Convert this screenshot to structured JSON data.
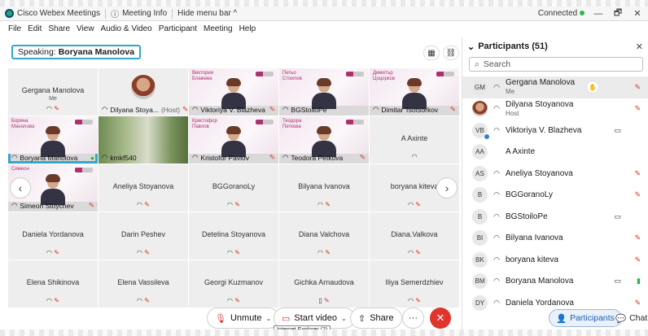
{
  "titlebar": {
    "app_name": "Cisco Webex Meetings",
    "meeting_info": "Meeting Info",
    "hide_menu": "Hide menu bar ^",
    "status": "Connected",
    "minimize": "—",
    "restore": "🗗",
    "close": "✕"
  },
  "menu": [
    "File",
    "Edit",
    "Share",
    "View",
    "Audio & Video",
    "Participant",
    "Meeting",
    "Help"
  ],
  "stage": {
    "speaking_prefix": "Speaking:",
    "speaking_name": "Boryana Manolova",
    "layout_icon": "grid-icon",
    "lock_icon": "link-icon"
  },
  "tiles": [
    {
      "name": "Gergana Manolova",
      "sub": "Me",
      "kind": "plain",
      "mic": "muted"
    },
    {
      "name": "Dilyana Stoya...",
      "extra": "(Host)",
      "kind": "avatar",
      "mic": "muted"
    },
    {
      "name": "Viktoriya V. Blazheva",
      "kind": "video",
      "slide": "Виктория\nБлажева",
      "mic": "muted"
    },
    {
      "name": "BGStoiloPe",
      "kind": "video",
      "slide": "Петьо\nСтоилов",
      "mic": "none"
    },
    {
      "name": "Dimitar Tsotsorkov",
      "kind": "video",
      "slide": "Димитър\nЦоцорков",
      "mic": "muted"
    },
    {
      "name": "Boryana Manolova",
      "kind": "video",
      "slide": "Боряна\nМанолова",
      "mic": "active",
      "active": true
    },
    {
      "name": "kmkf540",
      "kind": "forest",
      "mic": "none"
    },
    {
      "name": "Kristofor Pavlov",
      "kind": "video",
      "slide": "Кристофор\nПавлов",
      "mic": "muted"
    },
    {
      "name": "Teodora Petkova",
      "kind": "video",
      "slide": "Теодора\nПеткова",
      "mic": "muted"
    },
    {
      "name": "A Axinte",
      "kind": "plain",
      "mic": "none"
    },
    {
      "name": "Simeon Stoychev",
      "kind": "video",
      "slide": "Симеон",
      "mic": "muted"
    },
    {
      "name": "Aneliya Stoyanova",
      "kind": "plain",
      "mic": "muted"
    },
    {
      "name": "BGGoranoLy",
      "kind": "plain",
      "mic": "muted"
    },
    {
      "name": "Bilyana Ivanova",
      "kind": "plain",
      "mic": "muted"
    },
    {
      "name": "boryana kiteva",
      "kind": "plain",
      "mic": "muted"
    },
    {
      "name": "Daniela Yordanova",
      "kind": "plain",
      "mic": "muted"
    },
    {
      "name": "Darin Peshev",
      "kind": "plain",
      "mic": "muted"
    },
    {
      "name": "Detelina Stoyanova",
      "kind": "plain",
      "mic": "muted"
    },
    {
      "name": "Diana Valchova",
      "kind": "plain",
      "mic": "muted"
    },
    {
      "name": "Diana.Valkova",
      "kind": "plain",
      "mic": "muted"
    },
    {
      "name": "Elena Shikinova",
      "kind": "plain",
      "mic": "muted"
    },
    {
      "name": "Elena Vassileva",
      "kind": "plain",
      "mic": "muted"
    },
    {
      "name": "Georgi Kuzmanov",
      "kind": "plain",
      "mic": "muted"
    },
    {
      "name": "Gichka Arnaudova",
      "kind": "plain",
      "mic": "muted",
      "phone": true
    },
    {
      "name": "Iliya Semerdzhiev",
      "kind": "plain",
      "mic": "muted"
    }
  ],
  "toolbar": {
    "unmute": "Unmute",
    "start_video": "Start video",
    "share": "Share",
    "more": "···",
    "end": "✕",
    "tooltip": "Internet Explorer (2)"
  },
  "panel": {
    "title": "Participants (51)",
    "search_placeholder": "Search",
    "participants_btn": "Participants",
    "chat_btn": "Chat",
    "rows": [
      {
        "initials": "GM",
        "name": "Gergana Manolova",
        "role": "Me",
        "mic": "muted",
        "me": true
      },
      {
        "initials": "",
        "name": "Dilyana Stoyanova",
        "role": "Host",
        "mic": "muted",
        "photo": true
      },
      {
        "initials": "VB",
        "name": "Viktoriya V. Blazheva",
        "role": "",
        "mic": "none",
        "cam": true,
        "badge": true
      },
      {
        "initials": "AA",
        "name": "A Axinte",
        "role": "",
        "mic": "none",
        "noheadset": true
      },
      {
        "initials": "AS",
        "name": "Aneliya Stoyanova",
        "role": "",
        "mic": "muted"
      },
      {
        "initials": "B",
        "name": "BGGoranoLy",
        "role": "",
        "mic": "muted"
      },
      {
        "initials": "B",
        "name": "BGStoiloPe",
        "role": "",
        "mic": "none",
        "cam": true
      },
      {
        "initials": "BI",
        "name": "Bilyana Ivanova",
        "role": "",
        "mic": "muted"
      },
      {
        "initials": "BK",
        "name": "boryana kiteva",
        "role": "",
        "mic": "muted"
      },
      {
        "initials": "BM",
        "name": "Boryana Manolova",
        "role": "",
        "mic": "active",
        "cam": true
      },
      {
        "initials": "DY",
        "name": "Daniela Yordanova",
        "role": "",
        "mic": "muted"
      }
    ]
  },
  "colors": {
    "accent": "#32a8c8",
    "mute": "#d9342b",
    "end": "#e0352b",
    "connected": "#2fb34a"
  }
}
